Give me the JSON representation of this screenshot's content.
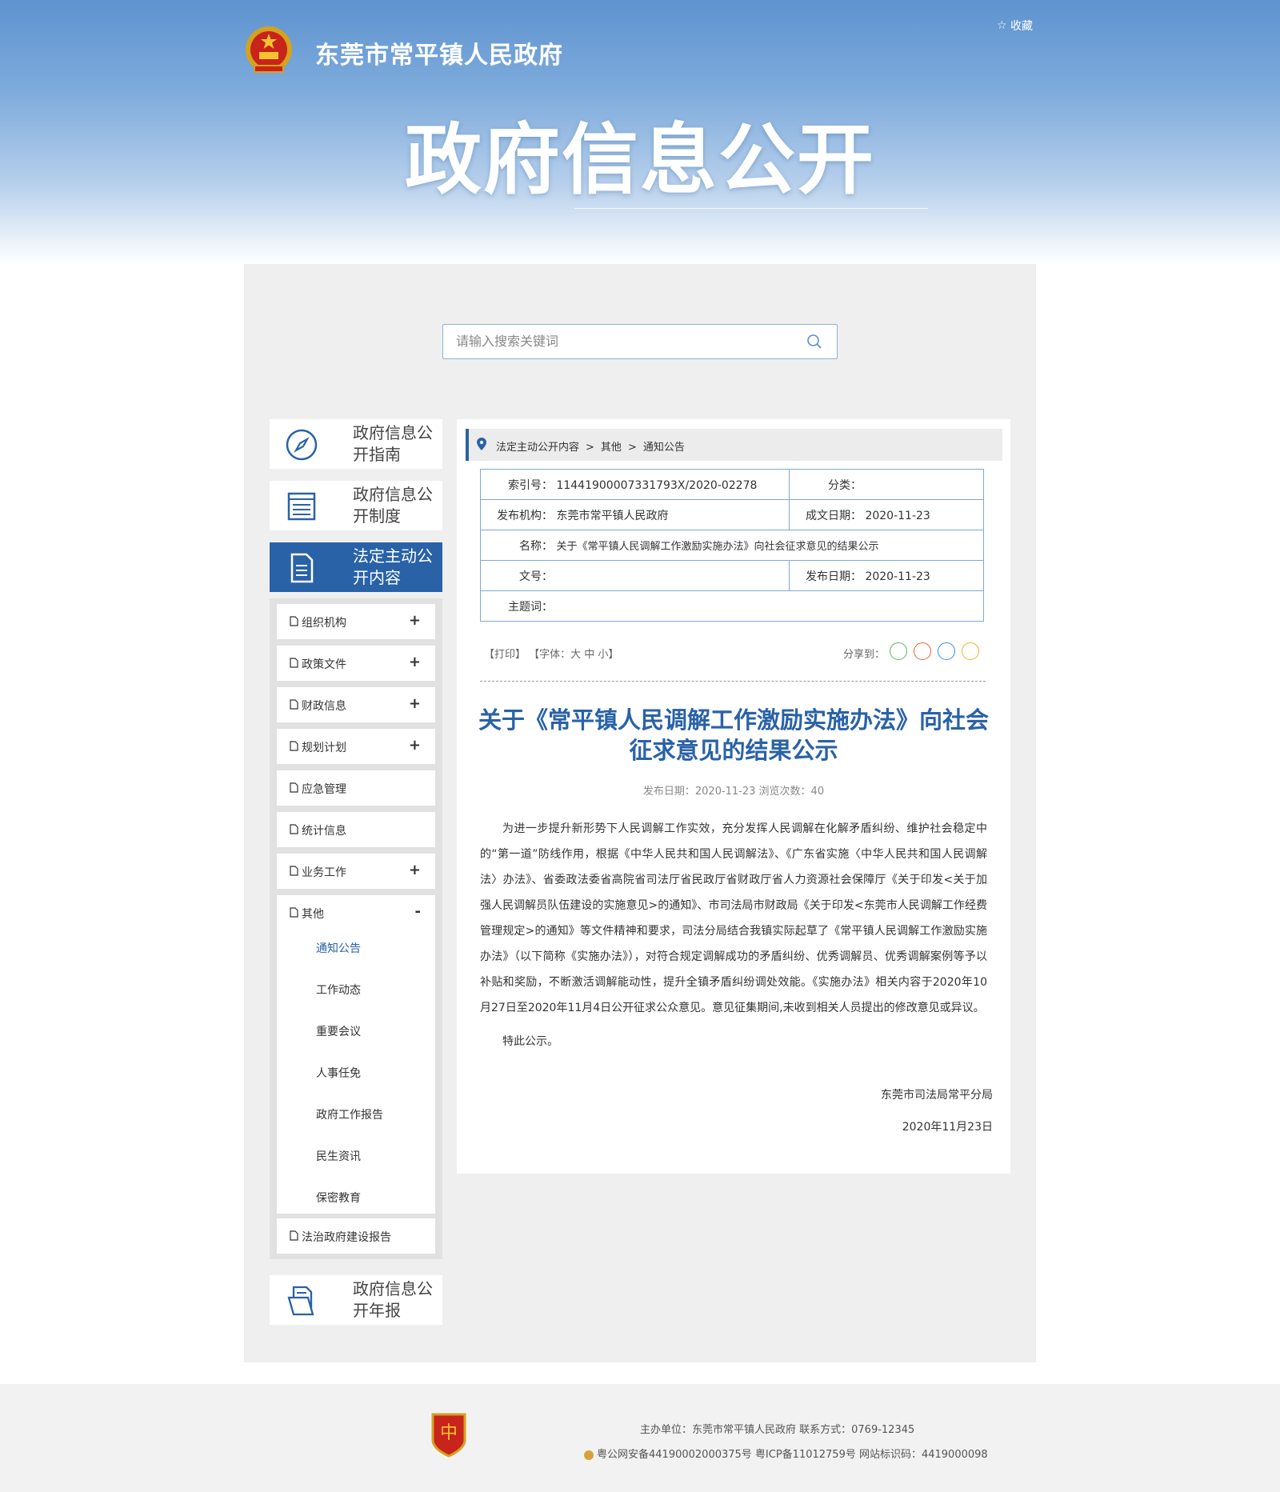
{
  "header": {
    "site_name": "东莞市常平镇人民政府",
    "favorite_label": "收藏",
    "hero_title": "政府信息公开"
  },
  "search": {
    "placeholder": "请输入搜索关键词"
  },
  "sidebar": {
    "guide_label": "政府信息公开指南",
    "system_label": "政府信息公开制度",
    "active_label": "法定主动公开内容",
    "annual_label": "政府信息公开年报",
    "sub_items": [
      {
        "label": "组织机构",
        "toggle": "+"
      },
      {
        "label": "政策文件",
        "toggle": "+"
      },
      {
        "label": "财政信息",
        "toggle": "+"
      },
      {
        "label": "规划计划",
        "toggle": "+"
      },
      {
        "label": "应急管理",
        "toggle": ""
      },
      {
        "label": "统计信息",
        "toggle": ""
      },
      {
        "label": "业务工作",
        "toggle": "+"
      },
      {
        "label": "其他",
        "toggle": "-"
      }
    ],
    "other_children": [
      "通知公告",
      "工作动态",
      "重要会议",
      "人事任免",
      "政府工作报告",
      "民生资讯",
      "保密教育"
    ],
    "last_item": "法治政府建设报告"
  },
  "breadcrumb": [
    "法定主动公开内容",
    "其他",
    "通知公告"
  ],
  "meta": {
    "index_key": "索引号：",
    "index_val": "11441900007331793X/2020-02278",
    "category_key": "分类：",
    "category_val": "",
    "org_key": "发布机构：",
    "org_val": "东莞市常平镇人民政府",
    "created_key": "成文日期：",
    "created_val": "2020-11-23",
    "name_key": "名称：",
    "name_val": "关于《常平镇人民调解工作激励实施办法》向社会征求意见的结果公示",
    "docno_key": "文号：",
    "docno_val": "",
    "pub_key": "发布日期：",
    "pub_val": "2020-11-23",
    "subject_key": "主题词：",
    "subject_val": ""
  },
  "tools": {
    "print": "【打印】",
    "font": "【字体：大  中  小】",
    "share_label": "分享到："
  },
  "article": {
    "title": "关于《常平镇人民调解工作激励实施办法》向社会征求意见的结果公示",
    "meta": "发布日期：2020-11-23  浏览次数：40",
    "body": "为进一步提升新形势下人民调解工作实效，充分发挥人民调解在化解矛盾纠纷、维护社会稳定中的“第一道”防线作用，根据《中华人民共和国人民调解法》、《广东省实施〈中华人民共和国人民调解法〉办法》、省委政法委省高院省司法厅省民政厅省财政厅省人力资源社会保障厅《关于印发<关于加强人民调解员队伍建设的实施意见>的通知》、市司法局市财政局《关于印发<东莞市人民调解工作经费管理规定>的通知》等文件精神和要求，司法分局结合我镇实际起草了《常平镇人民调解工作激励实施办法》（以下简称《实施办法》），对符合规定调解成功的矛盾纠纷、优秀调解员、优秀调解案例等予以补贴和奖励，不断激活调解能动性，提升全镇矛盾纠纷调处效能。《实施办法》相关内容于2020年10月27日至2020年11月4日公开征求公众意见。意见征集期间,未收到相关人员提出的修改意见或异议。",
    "closing": "特此公示。",
    "signer": "东莞市司法局常平分局",
    "sign_date": "2020年11月23日"
  },
  "footer": {
    "line1": "主办单位：东莞市常平镇人民政府    联系方式：0769-12345",
    "line2": "粤公网安备44190002000375号 粤ICP备11012759号 网站标识码：4419000098"
  }
}
